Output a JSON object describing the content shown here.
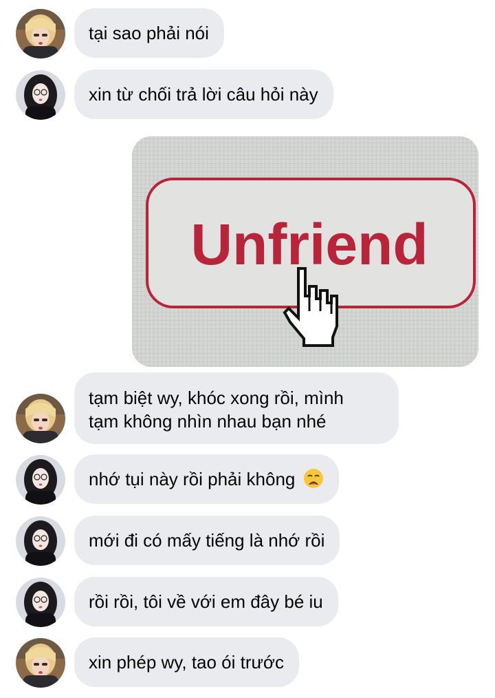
{
  "conversation": {
    "messages": [
      {
        "sender_avatar": "avatar-blonde",
        "text": "tại sao phải nói"
      },
      {
        "sender_avatar": "avatar-dark-hair",
        "text": "xin từ chối trả lời câu hỏi này"
      },
      {
        "type": "image",
        "image_text": "Unfriend",
        "image_icon": "hand-cursor-icon"
      },
      {
        "sender_avatar": "avatar-blonde",
        "line1": "tạm biệt wy, khóc xong rồi, mình",
        "line2": "tạm không nhìn nhau bạn nhé"
      },
      {
        "sender_avatar": "avatar-dark-hair",
        "text": "nhớ tụi này rồi phải không",
        "emoji": "weary-face-emoji"
      },
      {
        "sender_avatar": "avatar-dark-hair",
        "text": "mới đi có mấy tiếng là nhớ rồi"
      },
      {
        "sender_avatar": "avatar-dark-hair",
        "text": "rồi rồi, tôi về với em đây bé iu"
      },
      {
        "sender_avatar": "avatar-blonde",
        "text": "xin phép wy, tao ói trước"
      }
    ]
  },
  "colors": {
    "bubble_background": "#e9ebee",
    "text": "#050505",
    "unfriend_red": "#b8243a"
  }
}
